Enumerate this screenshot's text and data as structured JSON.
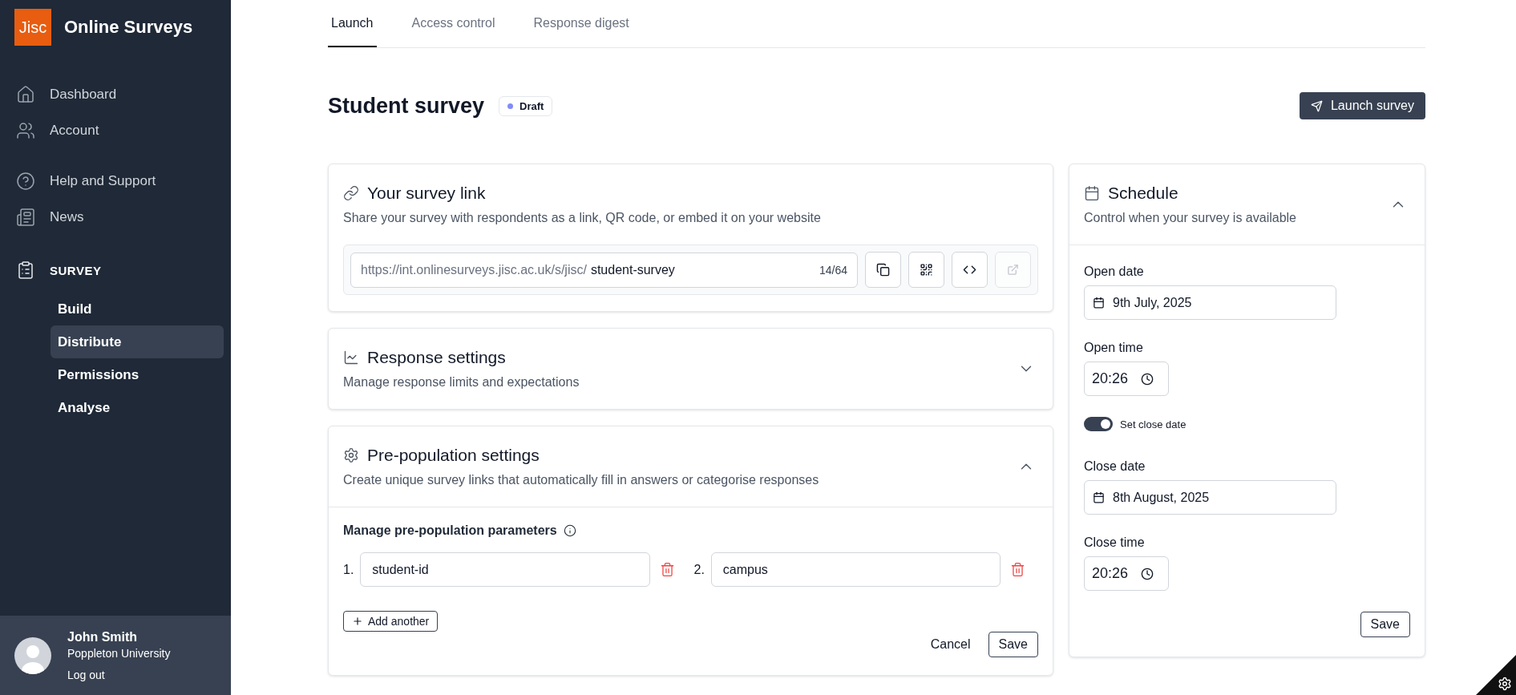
{
  "sidebar": {
    "logo": "Jisc",
    "app_name": "Online Surveys",
    "nav": [
      {
        "label": "Dashboard",
        "selected": false
      },
      {
        "label": "Account",
        "selected": false
      },
      {
        "label": "Help and Support",
        "selected": false
      },
      {
        "label": "News",
        "selected": false
      }
    ],
    "section": {
      "label": "SURVEY",
      "items": [
        {
          "label": "Build",
          "selected": false
        },
        {
          "label": "Distribute",
          "selected": true
        },
        {
          "label": "Permissions",
          "selected": false
        },
        {
          "label": "Analyse",
          "selected": false
        }
      ]
    },
    "user": {
      "name": "John Smith",
      "organisation": "Poppleton University",
      "logout": "Log out"
    }
  },
  "tabs": [
    {
      "label": "Launch",
      "selected": true
    },
    {
      "label": "Access control",
      "selected": false
    },
    {
      "label": "Response digest",
      "selected": false
    }
  ],
  "page": {
    "title": "Student survey",
    "status": {
      "label": "Draft",
      "color": "#818cf8"
    },
    "launch_button": "Launch survey"
  },
  "survey_link": {
    "title": "Your survey link",
    "subtitle": "Share your survey with respondents as a link, QR code, or embed it on your website",
    "url_prefix": "https://int.onlinesurveys.jisc.ac.uk/s/jisc/",
    "slug": "student-survey",
    "count": "14/64"
  },
  "response_settings": {
    "title": "Response settings",
    "subtitle": "Manage response limits and expectations",
    "expanded": false
  },
  "prepopulation": {
    "title": "Pre-population settings",
    "subtitle": "Create unique survey links that automatically fill in answers or categorise responses",
    "expanded": true,
    "params_label": "Manage pre-population parameters",
    "params": [
      {
        "number": "1.",
        "value": "student-id"
      },
      {
        "number": "2.",
        "value": "campus"
      }
    ],
    "add_button": "Add another",
    "cancel": "Cancel",
    "save": "Save"
  },
  "schedule": {
    "title": "Schedule",
    "subtitle": "Control when your survey is available",
    "expanded": true,
    "open_date_label": "Open date",
    "open_date": "9th July, 2025",
    "open_time_label": "Open time",
    "open_time": "20:26",
    "close_toggle": {
      "label": "Set close date",
      "on": true
    },
    "close_date_label": "Close date",
    "close_date": "8th August, 2025",
    "close_time_label": "Close time",
    "close_time": "20:26",
    "save": "Save"
  }
}
